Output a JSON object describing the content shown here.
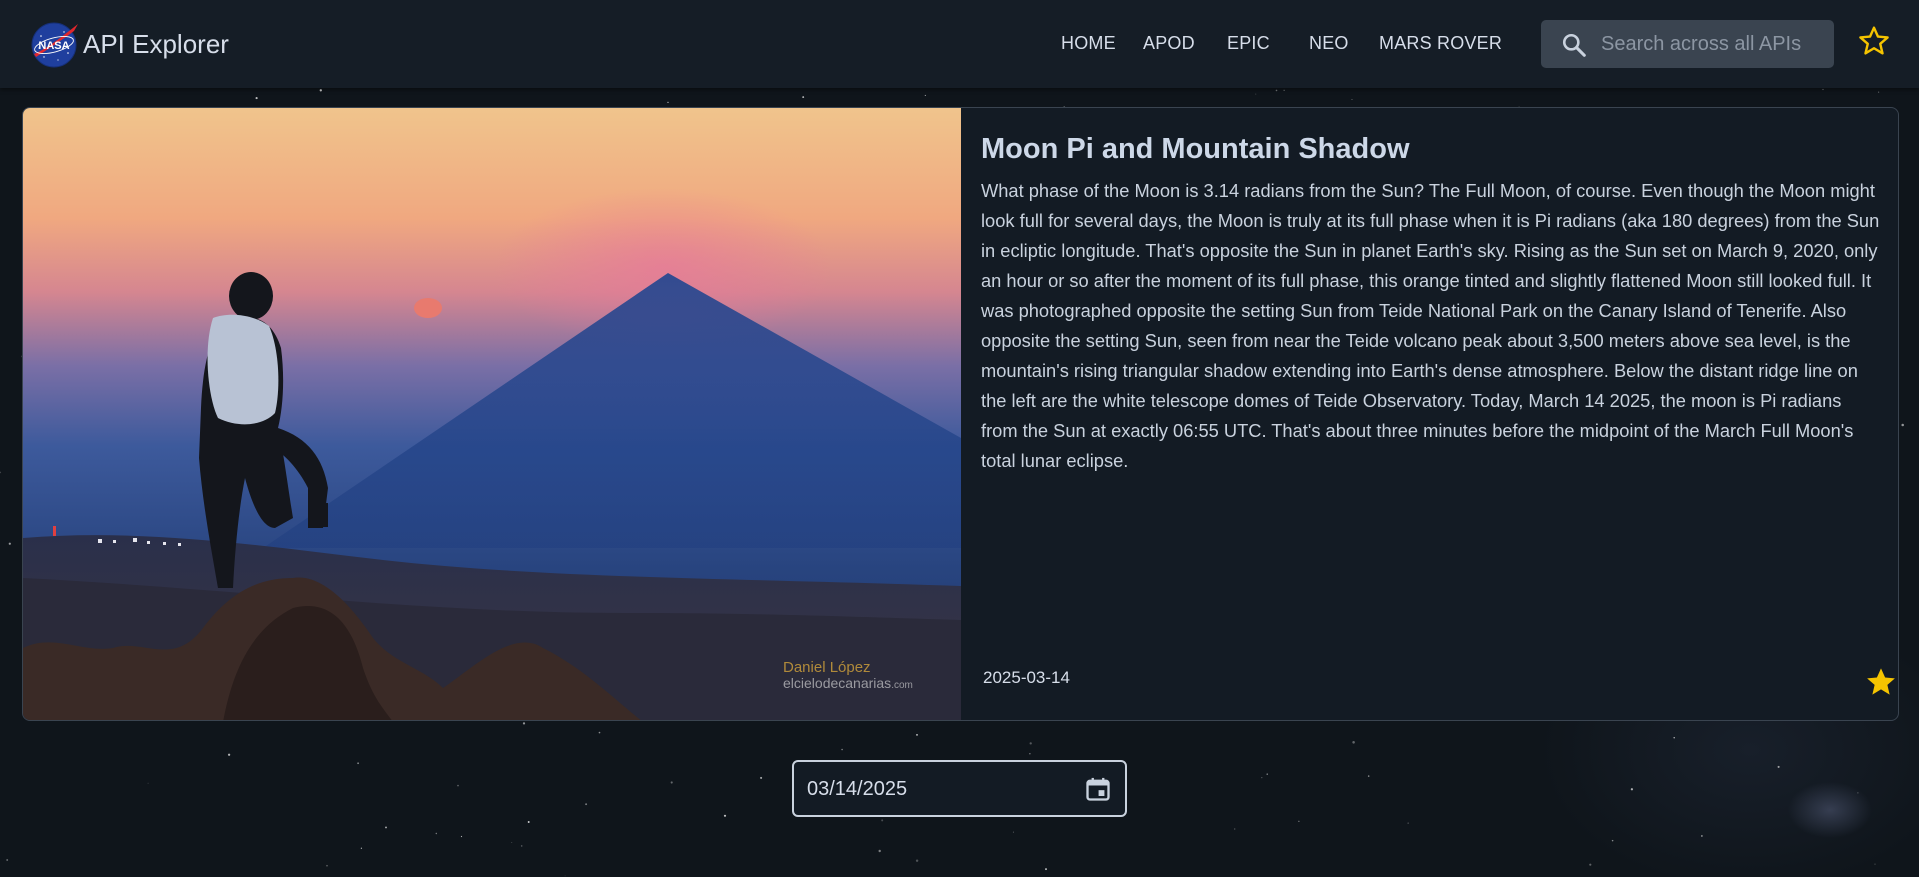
{
  "app": {
    "title": "API Explorer",
    "logo_text": "NASA"
  },
  "nav": {
    "items": [
      {
        "label": "HOME"
      },
      {
        "label": "APOD"
      },
      {
        "label": "EPIC"
      },
      {
        "label": "NEO"
      },
      {
        "label": "MARS ROVER"
      }
    ],
    "search_placeholder": "Search across all APIs",
    "favorites_icon": "star-outline-icon"
  },
  "apod": {
    "title": "Moon Pi and Mountain Shadow",
    "explanation": "What phase of the Moon is 3.14 radians from the Sun? The Full Moon, of course. Even though the Moon might look full for several days, the Moon is truly at its full phase when it is Pi radians (aka 180 degrees) from the Sun in ecliptic longitude. That's opposite the Sun in planet Earth's sky. Rising as the Sun set on March 9, 2020, only an hour or so after the moment of its full phase, this orange tinted and slightly flattened Moon still looked full. It was photographed opposite the setting Sun from Teide National Park on the Canary Island of Tenerife. Also opposite the setting Sun, seen from near the Teide volcano peak about 3,500 meters above sea level, is the mountain's rising triangular shadow extending into Earth's dense atmosphere. Below the distant ridge line on the left are the white telescope domes of Teide Observatory. Today, March 14 2025, the moon is Pi radians from the Sun at exactly 06:55 UTC. That's about three minutes before the midpoint of the March Full Moon's total lunar eclipse.",
    "date": "2025-03-14",
    "image_credit_name": "Daniel López",
    "image_credit_site": "elcielodecanarias",
    "image_credit_tld": ".com",
    "favorite_icon": "star-filled-icon",
    "favorited": true
  },
  "date_picker": {
    "value": "03/14/2025",
    "icon": "calendar-icon"
  },
  "colors": {
    "background": "#0f151b",
    "topbar": "#151d26",
    "card": "#131b24",
    "accent_star": "#f5c400"
  }
}
